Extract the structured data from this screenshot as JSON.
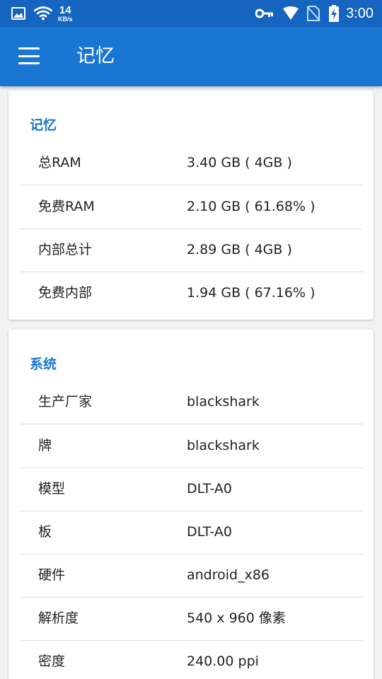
{
  "status_bar": {
    "net_speed_value": "14",
    "net_speed_unit": "KB/s",
    "time": "3:00",
    "icons": [
      "image-icon",
      "wifi-icon",
      "vpn-key-icon",
      "signal-icon",
      "no-sim-icon",
      "battery-charging-icon"
    ]
  },
  "app_bar": {
    "title": "记忆",
    "menu_icon": "menu-icon"
  },
  "memory_card": {
    "title": "记忆",
    "rows": [
      {
        "label": "总RAM",
        "value": "3.40 GB ( 4GB )"
      },
      {
        "label": "免费RAM",
        "value": "2.10 GB ( 61.68% )"
      },
      {
        "label": "内部总计",
        "value": "2.89 GB ( 4GB )"
      },
      {
        "label": "免费内部",
        "value": "1.94 GB ( 67.16% )"
      }
    ]
  },
  "system_card": {
    "title": "系统",
    "rows": [
      {
        "label": "生产厂家",
        "value": "blackshark"
      },
      {
        "label": "牌",
        "value": "blackshark"
      },
      {
        "label": "模型",
        "value": "DLT-A0"
      },
      {
        "label": "板",
        "value": "DLT-A0"
      },
      {
        "label": "硬件",
        "value": "android_x86"
      },
      {
        "label": "解析度",
        "value": "540 x 960 像素"
      },
      {
        "label": "密度",
        "value": "240.00 ppi"
      }
    ]
  },
  "colors": {
    "status_bar": "#1565C0",
    "app_bar": "#1976D2",
    "accent": "#1976D2",
    "background": "#F2F2F2"
  }
}
